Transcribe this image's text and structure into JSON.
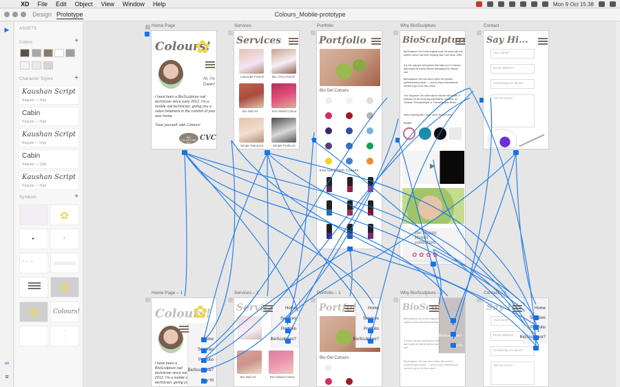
{
  "menubar": {
    "app": "XD",
    "items": [
      "File",
      "Edit",
      "Object",
      "View",
      "Window",
      "Help"
    ],
    "clock": "Mon 9 Oct  15:38"
  },
  "window": {
    "tabs": [
      "Design",
      "Prototype"
    ],
    "active_tab": "Prototype",
    "title": "Colours_Mobile-prototype"
  },
  "assets": {
    "heading": "ASSETS",
    "colors_heading": "Colors",
    "colors": [
      "#5a5148",
      "#a9a9a9",
      "#8b7a64",
      "#ffffff",
      "#9aa0a3",
      "#f4f2f4",
      "#ece9ee",
      "#d9d2d6"
    ],
    "char_heading": "Character Styles",
    "char_styles": [
      {
        "name": "Kaushan Script",
        "meta": "Regular — 40pt"
      },
      {
        "name": "Cabin",
        "meta": "Regular — 20pt"
      },
      {
        "name": "Kaushan Script",
        "meta": "Regular — 50pt"
      },
      {
        "name": "Cabin",
        "meta": "Regular — 15pt"
      },
      {
        "name": "Kaushan Script",
        "meta": "Regular — 30pt"
      }
    ],
    "symbols_heading": "Symbols",
    "symbol_logo_text": "Colours!"
  },
  "artboards": {
    "home": {
      "label": "Home Page",
      "title": "Colours!",
      "greeting": "Hi, I'm Dawn!",
      "body": "I have been a BioSculpture nail technician since early 2012. I'm a mobile nail technician, giving you a salon treatment in the comfort of your own home.",
      "tagline": "Treat yourself, with Colours!",
      "badge": "BIO SCULPTURE GEL",
      "cvc": "CVC"
    },
    "services": {
      "label": "Services",
      "title": "Services",
      "captions": [
        "Lavender French",
        "Bio / Evo French",
        "Bio Nail Art",
        "Evo Mixed Colour",
        "Simple Manicure",
        "Simple Pedicure"
      ]
    },
    "portfolio": {
      "label": "Portfolio",
      "title": "Portfolio",
      "bio_heading": "Bio Gel Colours",
      "evo_heading": "Evo Gel Polish Colours:"
    },
    "why": {
      "label": "Why BioSculpture",
      "title": "BioSculpture?",
      "paras": [
        "BioSculpture Gel is the original soak off colour gel nail system which has been leading Nail Care since 1989.",
        "It is the only gel nail system that lasts up to 3 weeks and soaks off easily without damaging the natural nail.",
        "BioSculpture Gel has been voted 'the perfect professional product' — and is many international women's go-to for this colour.",
        "The Sculpture Gel cares about natural nail health. It features no de-nouncing ingredients, contains no Toluene, Formaldehyde or Formaldehyde Resin."
      ],
      "quote": "Since learning Bio I have never looked back.",
      "sig": "Dawn",
      "footer_text": "the Happy Hands collection"
    },
    "contact": {
      "label": "Contact",
      "title": "Say Hi...",
      "fields": [
        "Your name*",
        "Email address*",
        "Contacting me about?",
        "Tell me more?"
      ]
    },
    "home1": {
      "label": "Home Page – 1",
      "title": "Colours!",
      "body": "I have been a BioSculpture nail technician since early 2012. I'm a mobile nail technician, giving you a salon"
    },
    "services1": {
      "label": "Services – 1",
      "title": "Services",
      "captions": [
        "Bio Nail Art",
        "Evo Mixed Colour"
      ]
    },
    "portfolio1": {
      "label": "Portfolio – 1",
      "title": "Portfolio",
      "bio_heading": "Bio Gel Colours"
    },
    "why1": {
      "label": "Why BioSculpture – 1",
      "title": "BioSculpture?"
    },
    "contact1": {
      "label": "Contact – 1",
      "title": "Say Hi...",
      "fields": [
        "Your name*",
        "Email address*",
        "Contacting me about?",
        "Tell me more?"
      ]
    }
  },
  "nav_menu": [
    "Home",
    "Services",
    "Portfolio",
    "BioSculpture?",
    "Say Hi"
  ]
}
